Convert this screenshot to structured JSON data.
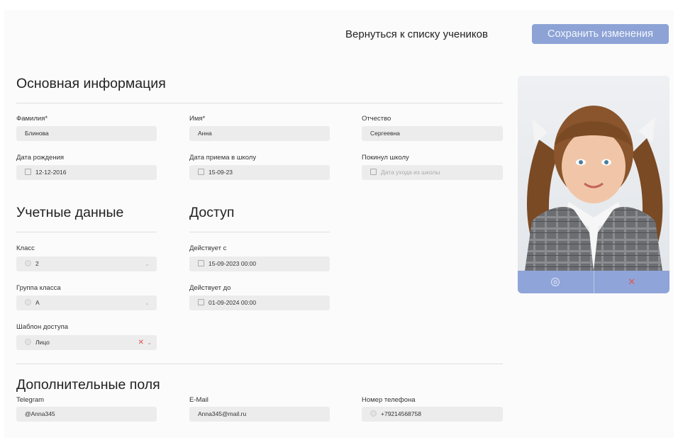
{
  "header": {
    "back_link": "Вернуться к списку учеников",
    "save_button": "Сохранить изменения"
  },
  "basic": {
    "title": "Основная информация",
    "surname_label": "Фамилия*",
    "surname_value": "Блинова",
    "name_label": "Имя*",
    "name_value": "Анна",
    "patronymic_label": "Отчество",
    "patronymic_value": "Сергеевна",
    "birth_label": "Дата рождения",
    "birth_value": "12-12-2016",
    "admission_label": "Дата приема в школу",
    "admission_value": "15-09-23",
    "left_label": "Покинул школу",
    "left_placeholder": "Дата ухода из школы"
  },
  "account": {
    "title": "Учетные данные",
    "class_label": "Класс",
    "class_value": "2",
    "group_label": "Группа класса",
    "group_value": "А",
    "template_label": "Шаблон доступа",
    "template_value": "Лицо"
  },
  "access": {
    "title": "Доступ",
    "from_label": "Действует с",
    "from_value": "15-09-2023 00:00",
    "to_label": "Действует до",
    "to_value": "01-09-2024 00:00"
  },
  "extra": {
    "title": "Дополнительные поля",
    "telegram_label": "Telegram",
    "telegram_value": "@Anna345",
    "email_label": "E-Mail",
    "email_value": "Anna345@mail.ru",
    "phone_label": "Номер телефона",
    "phone_value": "+79214568758"
  },
  "photo": {
    "actions": [
      "camera-icon",
      "delete-icon"
    ]
  },
  "colors": {
    "accent": "#8da3d6",
    "field_bg": "#ececec",
    "danger": "#e04848"
  }
}
